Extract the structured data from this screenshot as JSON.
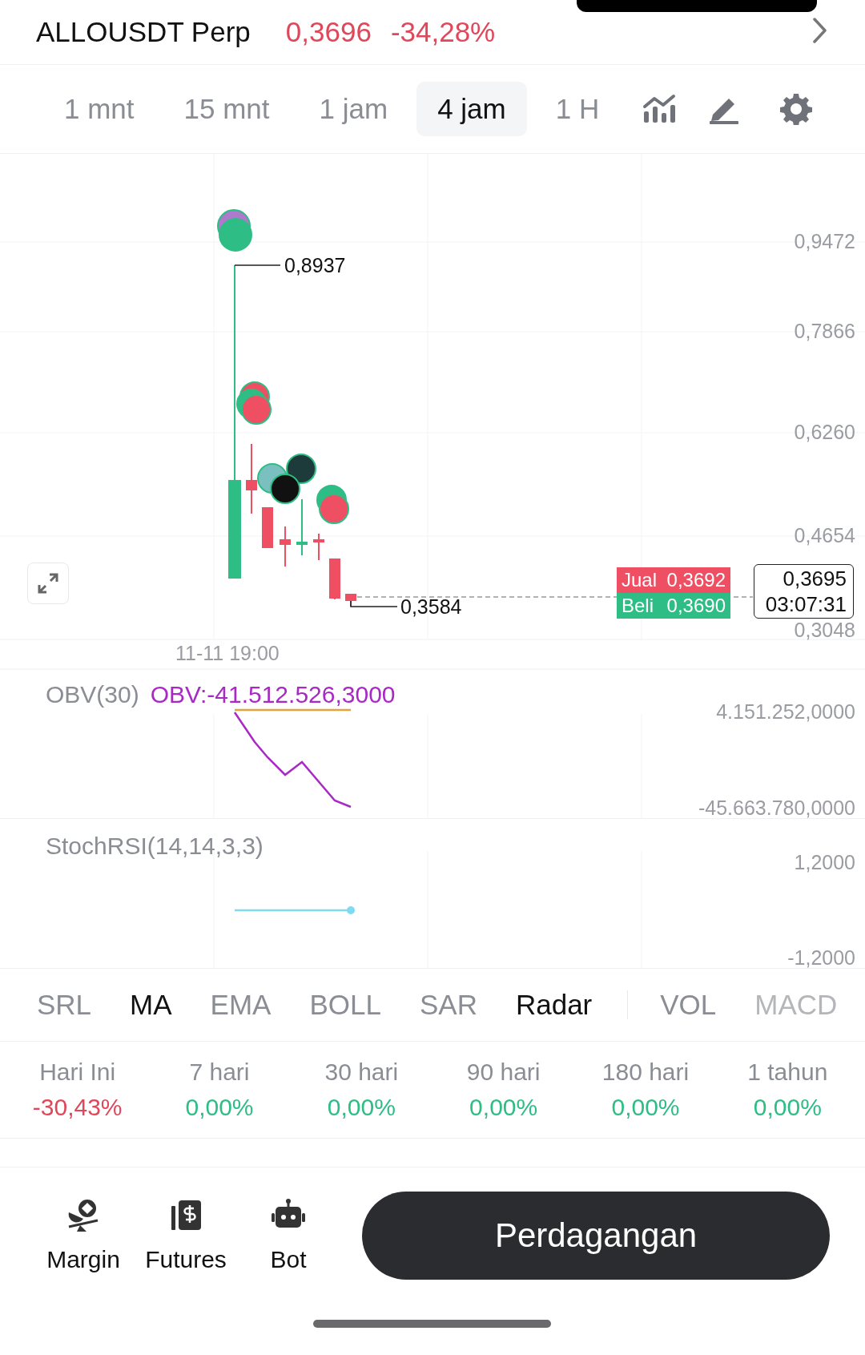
{
  "header": {
    "symbol": "ALLOUSDT Perp",
    "price": "0,3696",
    "change": "-34,28%"
  },
  "intervals": [
    {
      "label": "1 mnt",
      "selected": false
    },
    {
      "label": "15 mnt",
      "selected": false
    },
    {
      "label": "1 jam",
      "selected": false
    },
    {
      "label": "4 jam",
      "selected": true
    },
    {
      "label": "1 H",
      "selected": false
    }
  ],
  "main_chart": {
    "price_axis": [
      "0,9472",
      "0,7866",
      "0,6260",
      "0,4654",
      "0,3048"
    ],
    "high_label": "0,8937",
    "low_label": "0,3584",
    "ask": {
      "label": "Jual",
      "value": "0,3692"
    },
    "bid": {
      "label": "Beli",
      "value": "0,3690"
    },
    "last_price": "0,3695",
    "countdown": "03:07:31",
    "time_label": "11-11 19:00"
  },
  "obv": {
    "title": "OBV(30)",
    "value": "OBV:-41.512.526,3000",
    "axis": [
      "4.151.252,0000",
      "-45.663.780,0000"
    ]
  },
  "stoch_rsi": {
    "title": "StochRSI(14,14,3,3)",
    "axis": [
      "1,2000",
      "-1,2000"
    ]
  },
  "main_indicators": [
    {
      "label": "SRL",
      "selected": false
    },
    {
      "label": "MA",
      "selected": true
    },
    {
      "label": "EMA",
      "selected": false
    },
    {
      "label": "BOLL",
      "selected": false
    },
    {
      "label": "SAR",
      "selected": false
    },
    {
      "label": "Radar",
      "selected": true
    }
  ],
  "sub_indicators": [
    {
      "label": "VOL",
      "selected": false
    },
    {
      "label": "MACD",
      "selected": false
    }
  ],
  "performance": [
    {
      "period": "Hari Ini",
      "change": "-30,43%",
      "color": "#e0475b"
    },
    {
      "period": "7 hari",
      "change": "0,00%",
      "color": "#2ebd85"
    },
    {
      "period": "30 hari",
      "change": "0,00%",
      "color": "#2ebd85"
    },
    {
      "period": "90 hari",
      "change": "0,00%",
      "color": "#2ebd85"
    },
    {
      "period": "180 hari",
      "change": "0,00%",
      "color": "#2ebd85"
    },
    {
      "period": "1 tahun",
      "change": "0,00%",
      "color": "#2ebd85"
    }
  ],
  "bottom_nav": [
    {
      "label": "Margin",
      "kind": "margin"
    },
    {
      "label": "Futures",
      "kind": "futures"
    },
    {
      "label": "Bot",
      "kind": "bot"
    }
  ],
  "trade_button": "Perdagangan"
}
